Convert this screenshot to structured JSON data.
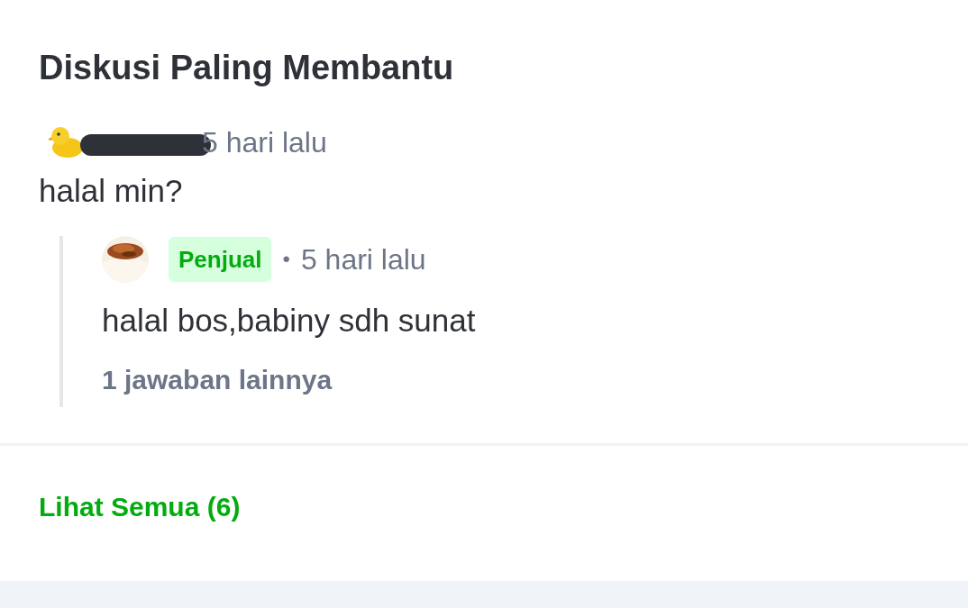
{
  "title": "Diskusi Paling Membantu",
  "question": {
    "time": "5 hari lalu",
    "text": "halal min?"
  },
  "reply": {
    "badge": "Penjual",
    "separator": "•",
    "time": "5 hari lalu",
    "text": "halal bos,babiny sdh sunat",
    "more": "1 jawaban lainnya"
  },
  "footer_link": "Lihat Semua (6)"
}
